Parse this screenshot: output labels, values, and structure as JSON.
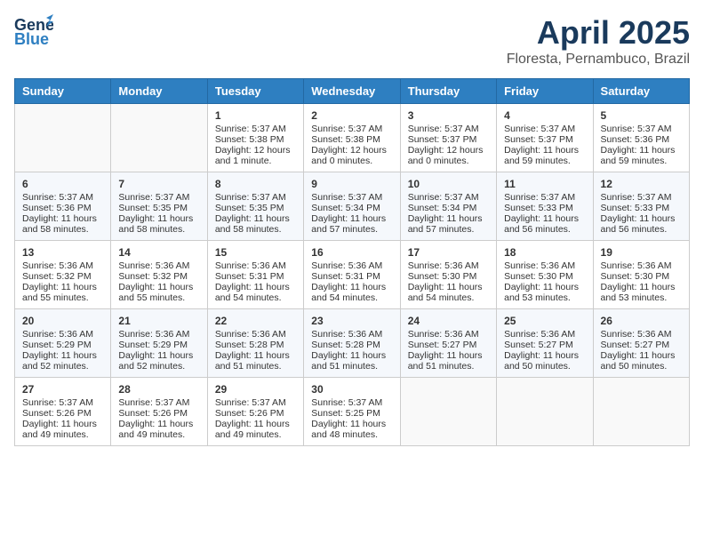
{
  "header": {
    "logo_line1": "General",
    "logo_line2": "Blue",
    "title": "April 2025",
    "subtitle": "Floresta, Pernambuco, Brazil"
  },
  "weekdays": [
    "Sunday",
    "Monday",
    "Tuesday",
    "Wednesday",
    "Thursday",
    "Friday",
    "Saturday"
  ],
  "weeks": [
    [
      {
        "day": "",
        "content": ""
      },
      {
        "day": "",
        "content": ""
      },
      {
        "day": "1",
        "content": "Sunrise: 5:37 AM\nSunset: 5:38 PM\nDaylight: 12 hours and 1 minute."
      },
      {
        "day": "2",
        "content": "Sunrise: 5:37 AM\nSunset: 5:38 PM\nDaylight: 12 hours and 0 minutes."
      },
      {
        "day": "3",
        "content": "Sunrise: 5:37 AM\nSunset: 5:37 PM\nDaylight: 12 hours and 0 minutes."
      },
      {
        "day": "4",
        "content": "Sunrise: 5:37 AM\nSunset: 5:37 PM\nDaylight: 11 hours and 59 minutes."
      },
      {
        "day": "5",
        "content": "Sunrise: 5:37 AM\nSunset: 5:36 PM\nDaylight: 11 hours and 59 minutes."
      }
    ],
    [
      {
        "day": "6",
        "content": "Sunrise: 5:37 AM\nSunset: 5:36 PM\nDaylight: 11 hours and 58 minutes."
      },
      {
        "day": "7",
        "content": "Sunrise: 5:37 AM\nSunset: 5:35 PM\nDaylight: 11 hours and 58 minutes."
      },
      {
        "day": "8",
        "content": "Sunrise: 5:37 AM\nSunset: 5:35 PM\nDaylight: 11 hours and 58 minutes."
      },
      {
        "day": "9",
        "content": "Sunrise: 5:37 AM\nSunset: 5:34 PM\nDaylight: 11 hours and 57 minutes."
      },
      {
        "day": "10",
        "content": "Sunrise: 5:37 AM\nSunset: 5:34 PM\nDaylight: 11 hours and 57 minutes."
      },
      {
        "day": "11",
        "content": "Sunrise: 5:37 AM\nSunset: 5:33 PM\nDaylight: 11 hours and 56 minutes."
      },
      {
        "day": "12",
        "content": "Sunrise: 5:37 AM\nSunset: 5:33 PM\nDaylight: 11 hours and 56 minutes."
      }
    ],
    [
      {
        "day": "13",
        "content": "Sunrise: 5:36 AM\nSunset: 5:32 PM\nDaylight: 11 hours and 55 minutes."
      },
      {
        "day": "14",
        "content": "Sunrise: 5:36 AM\nSunset: 5:32 PM\nDaylight: 11 hours and 55 minutes."
      },
      {
        "day": "15",
        "content": "Sunrise: 5:36 AM\nSunset: 5:31 PM\nDaylight: 11 hours and 54 minutes."
      },
      {
        "day": "16",
        "content": "Sunrise: 5:36 AM\nSunset: 5:31 PM\nDaylight: 11 hours and 54 minutes."
      },
      {
        "day": "17",
        "content": "Sunrise: 5:36 AM\nSunset: 5:30 PM\nDaylight: 11 hours and 54 minutes."
      },
      {
        "day": "18",
        "content": "Sunrise: 5:36 AM\nSunset: 5:30 PM\nDaylight: 11 hours and 53 minutes."
      },
      {
        "day": "19",
        "content": "Sunrise: 5:36 AM\nSunset: 5:30 PM\nDaylight: 11 hours and 53 minutes."
      }
    ],
    [
      {
        "day": "20",
        "content": "Sunrise: 5:36 AM\nSunset: 5:29 PM\nDaylight: 11 hours and 52 minutes."
      },
      {
        "day": "21",
        "content": "Sunrise: 5:36 AM\nSunset: 5:29 PM\nDaylight: 11 hours and 52 minutes."
      },
      {
        "day": "22",
        "content": "Sunrise: 5:36 AM\nSunset: 5:28 PM\nDaylight: 11 hours and 51 minutes."
      },
      {
        "day": "23",
        "content": "Sunrise: 5:36 AM\nSunset: 5:28 PM\nDaylight: 11 hours and 51 minutes."
      },
      {
        "day": "24",
        "content": "Sunrise: 5:36 AM\nSunset: 5:27 PM\nDaylight: 11 hours and 51 minutes."
      },
      {
        "day": "25",
        "content": "Sunrise: 5:36 AM\nSunset: 5:27 PM\nDaylight: 11 hours and 50 minutes."
      },
      {
        "day": "26",
        "content": "Sunrise: 5:36 AM\nSunset: 5:27 PM\nDaylight: 11 hours and 50 minutes."
      }
    ],
    [
      {
        "day": "27",
        "content": "Sunrise: 5:37 AM\nSunset: 5:26 PM\nDaylight: 11 hours and 49 minutes."
      },
      {
        "day": "28",
        "content": "Sunrise: 5:37 AM\nSunset: 5:26 PM\nDaylight: 11 hours and 49 minutes."
      },
      {
        "day": "29",
        "content": "Sunrise: 5:37 AM\nSunset: 5:26 PM\nDaylight: 11 hours and 49 minutes."
      },
      {
        "day": "30",
        "content": "Sunrise: 5:37 AM\nSunset: 5:25 PM\nDaylight: 11 hours and 48 minutes."
      },
      {
        "day": "",
        "content": ""
      },
      {
        "day": "",
        "content": ""
      },
      {
        "day": "",
        "content": ""
      }
    ]
  ]
}
